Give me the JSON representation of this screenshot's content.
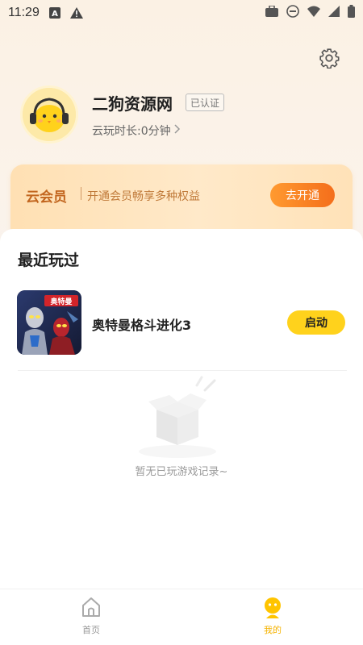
{
  "status_bar": {
    "time": "11:29",
    "left_icons": [
      "a-icon",
      "warning-icon"
    ],
    "right_icons": [
      "briefcase-icon",
      "dnd-icon",
      "wifi-icon",
      "signal-icon",
      "battery-icon"
    ]
  },
  "profile": {
    "name": "二狗资源网",
    "badge": "已认证",
    "playtime": "云玩时长:0分钟",
    "settings_icon": "gear-icon"
  },
  "vip": {
    "title": "云会员",
    "description": "开通会员畅享多种权益",
    "button": "去开通"
  },
  "recent": {
    "title": "最近玩过",
    "games": [
      {
        "name": "奥特曼格斗进化3",
        "action": "启动"
      }
    ],
    "empty_text": "暂无已玩游戏记录~"
  },
  "tabbar": {
    "home": "首页",
    "mine": "我的"
  },
  "colors": {
    "accent": "#ffd21c",
    "vip_button": "#f46e1b",
    "tab_active": "#f5b300"
  }
}
